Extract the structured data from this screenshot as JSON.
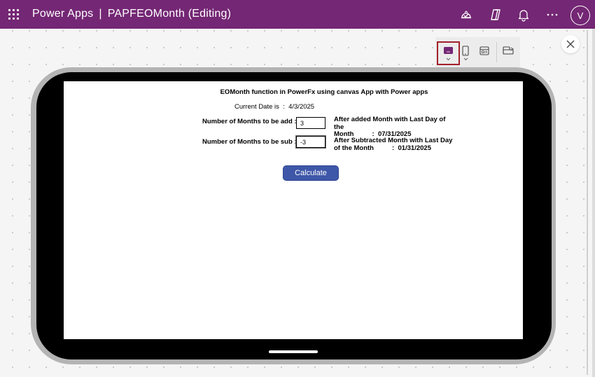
{
  "header": {
    "app_name": "Power Apps",
    "separator": "|",
    "document_title": "PAPFEOMonth (Editing)",
    "icons": [
      "app-checker-icon",
      "copilot-icon",
      "notifications-icon",
      "more-icon"
    ],
    "avatar_initial": "V",
    "bar_color": "#742774"
  },
  "device_toolbar": {
    "items": [
      "tablet-icon",
      "phone-icon",
      "screen-size-icon",
      "web-layout-icon"
    ],
    "selected": "tablet-icon"
  },
  "canvas_screen": {
    "title": "EOMonth function in PowerFx using canvas App with Power apps",
    "current_date_label": "Current Date is",
    "current_date_sep": ":",
    "current_date_value": "4/3/2025",
    "add_label": "Number of Months to be add :",
    "add_value": "3",
    "sub_label": "Number of Months to be sub :",
    "sub_value": "-3",
    "add_result_line1": "After added Month with Last Day of the",
    "add_result_line2_label": "Month",
    "add_result_sep": ":",
    "add_result_value": "07/31/2025",
    "sub_result_line1": "After Subtracted Month with Last Day",
    "sub_result_line2_label": "of the Month",
    "sub_result_sep": ":",
    "sub_result_value": "01/31/2025",
    "calculate_label": "Calculate",
    "button_color": "#3e57a8"
  }
}
